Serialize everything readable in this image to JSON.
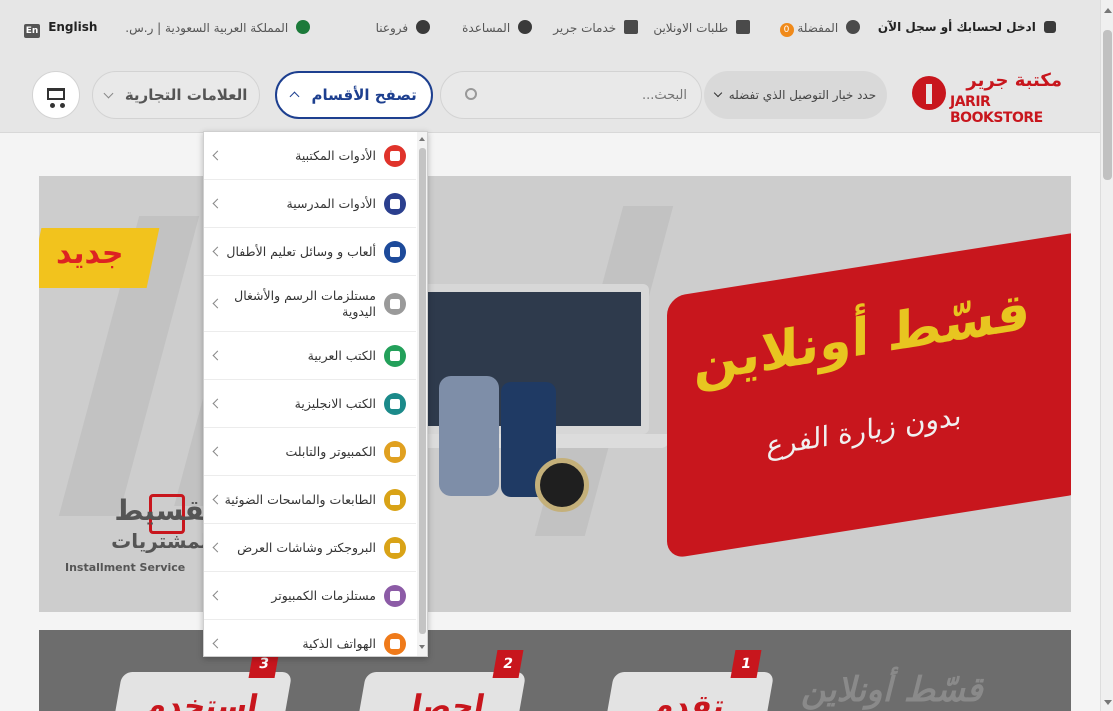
{
  "topbar": {
    "login": "ادخل لحسابك أو سجل الآن",
    "favorites": "المفضلة",
    "favorites_count": "0",
    "online_orders": "طلبات الاونلاين",
    "jarir_services": "خدمات جرير",
    "help": "المساعدة",
    "branches": "فروعنا",
    "region": "المملكة العربية السعودية | ر.س.",
    "language": "English",
    "language_badge": "En"
  },
  "header": {
    "logo_ar": "مكتبة جرير",
    "logo_en": "JARIR BOOKSTORE",
    "delivery": "حدد خيار التوصيل الذي تفضله",
    "search_placeholder": "البحث...",
    "browse": "تصفح الأقسام",
    "brands": "العلامات التجارية"
  },
  "hero": {
    "badge_new": "جديد",
    "title": "قسّط أونلاين",
    "subtitle": "بدون زيارة الفرع",
    "installment_ar_1": "تقسيط",
    "installment_ar_2": "المشتريات",
    "installment_en": "Installment Service"
  },
  "lower": {
    "steps": [
      {
        "num": "1",
        "label": "تقدم"
      },
      {
        "num": "2",
        "label": "احصل"
      },
      {
        "num": "3",
        "label": "استخدم"
      }
    ],
    "title": "قسّط أونلاين"
  },
  "menu": {
    "items": [
      {
        "label": "الأدوات المكتبية",
        "icon": "office-supplies-icon",
        "color": "#e0332b"
      },
      {
        "label": "الأدوات المدرسية",
        "icon": "pen-icon",
        "color": "#2b3f8e"
      },
      {
        "label": "ألعاب و وسائل تعليم الأطفال",
        "icon": "toy-cube-icon",
        "color": "#1d4a9a"
      },
      {
        "label": "مستلزمات الرسم والأشغال اليدوية",
        "icon": "brush-icon",
        "color": "#9a9a9a"
      },
      {
        "label": "الكتب العربية",
        "icon": "arabic-book-icon",
        "color": "#23a05a"
      },
      {
        "label": "الكتب الانجليزية",
        "icon": "english-book-icon",
        "color": "#1b8a8a"
      },
      {
        "label": "الكمبيوتر والتابلت",
        "icon": "computer-icon",
        "color": "#e0a020"
      },
      {
        "label": "الطابعات والماسحات الضوئية",
        "icon": "printer-icon",
        "color": "#d9a317"
      },
      {
        "label": "البروجكتر وشاشات العرض",
        "icon": "projector-icon",
        "color": "#d9a317"
      },
      {
        "label": "مستلزمات الكمبيوتر",
        "icon": "keyboard-icon",
        "color": "#8c5ba6"
      },
      {
        "label": "الهواتف الذكية",
        "icon": "smartphone-icon",
        "color": "#ef7a1a"
      }
    ]
  }
}
